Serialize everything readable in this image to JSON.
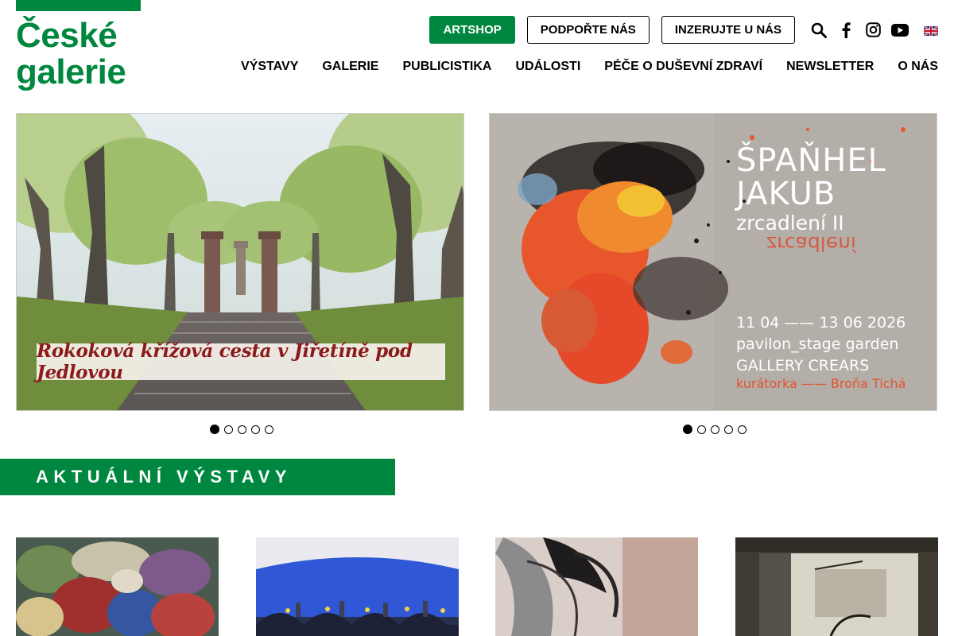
{
  "logo": {
    "line1": "České",
    "line2": "galerie"
  },
  "topbar": {
    "artshop": "ARTSHOP",
    "support": "PODPOŘTE NÁS",
    "advertise": "INZERUJTE U NÁS"
  },
  "icons": [
    "search-icon",
    "facebook-icon",
    "instagram-icon",
    "youtube-icon",
    "english-flag-icon"
  ],
  "nav": [
    "VÝSTAVY",
    "GALERIE",
    "PUBLICISTIKA",
    "UDÁLOSTI",
    "PÉČE O DUŠEVNÍ ZDRAVÍ",
    "NEWSLETTER",
    "O NÁS"
  ],
  "slider_left": {
    "caption": "Rokoková křížová cesta v Jiřetíně pod Jedlovou",
    "dots": 5,
    "active_dot": 1
  },
  "slider_right": {
    "name1": "ŠPAŇHEL",
    "name2": "JAKUB",
    "subtitle": "zrcadlení II",
    "mirror": "zrcadlení",
    "dates": "11 04 —— 13 06 2026",
    "venue": "pavilon_stage garden",
    "gallery": "GALLERY CREARS",
    "curator": "kurátorka —— Broňa Tichá",
    "dots": 5,
    "active_dot": 1
  },
  "section": {
    "title": "AKTUÁLNÍ VÝSTAVY"
  },
  "colors": {
    "brand_green": "#00873f",
    "text": "#000000",
    "poster_orange": "#e2542f"
  }
}
